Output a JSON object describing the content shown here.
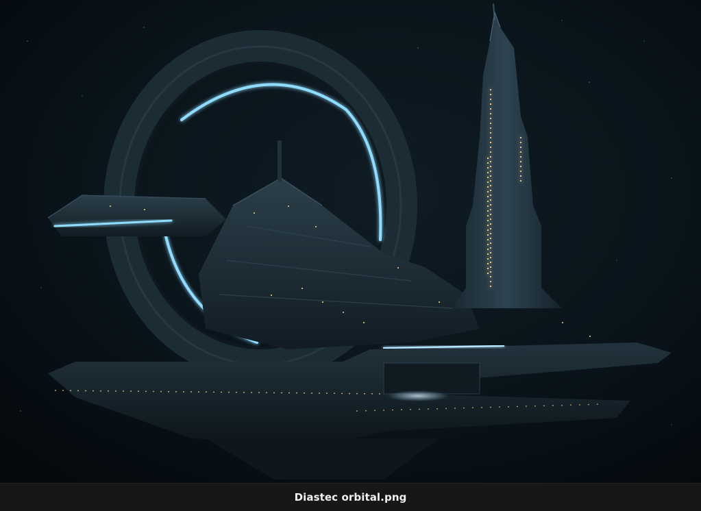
{
  "viewer": {
    "filename": "Diastec orbital.png"
  },
  "image": {
    "subject": "orbital-station",
    "colors": {
      "space": "#0a141a",
      "hull": "#1b2a33",
      "hull_light": "#2c404b",
      "ring_glow": "#7fd6ff",
      "window_light": "#e8c98a"
    }
  }
}
